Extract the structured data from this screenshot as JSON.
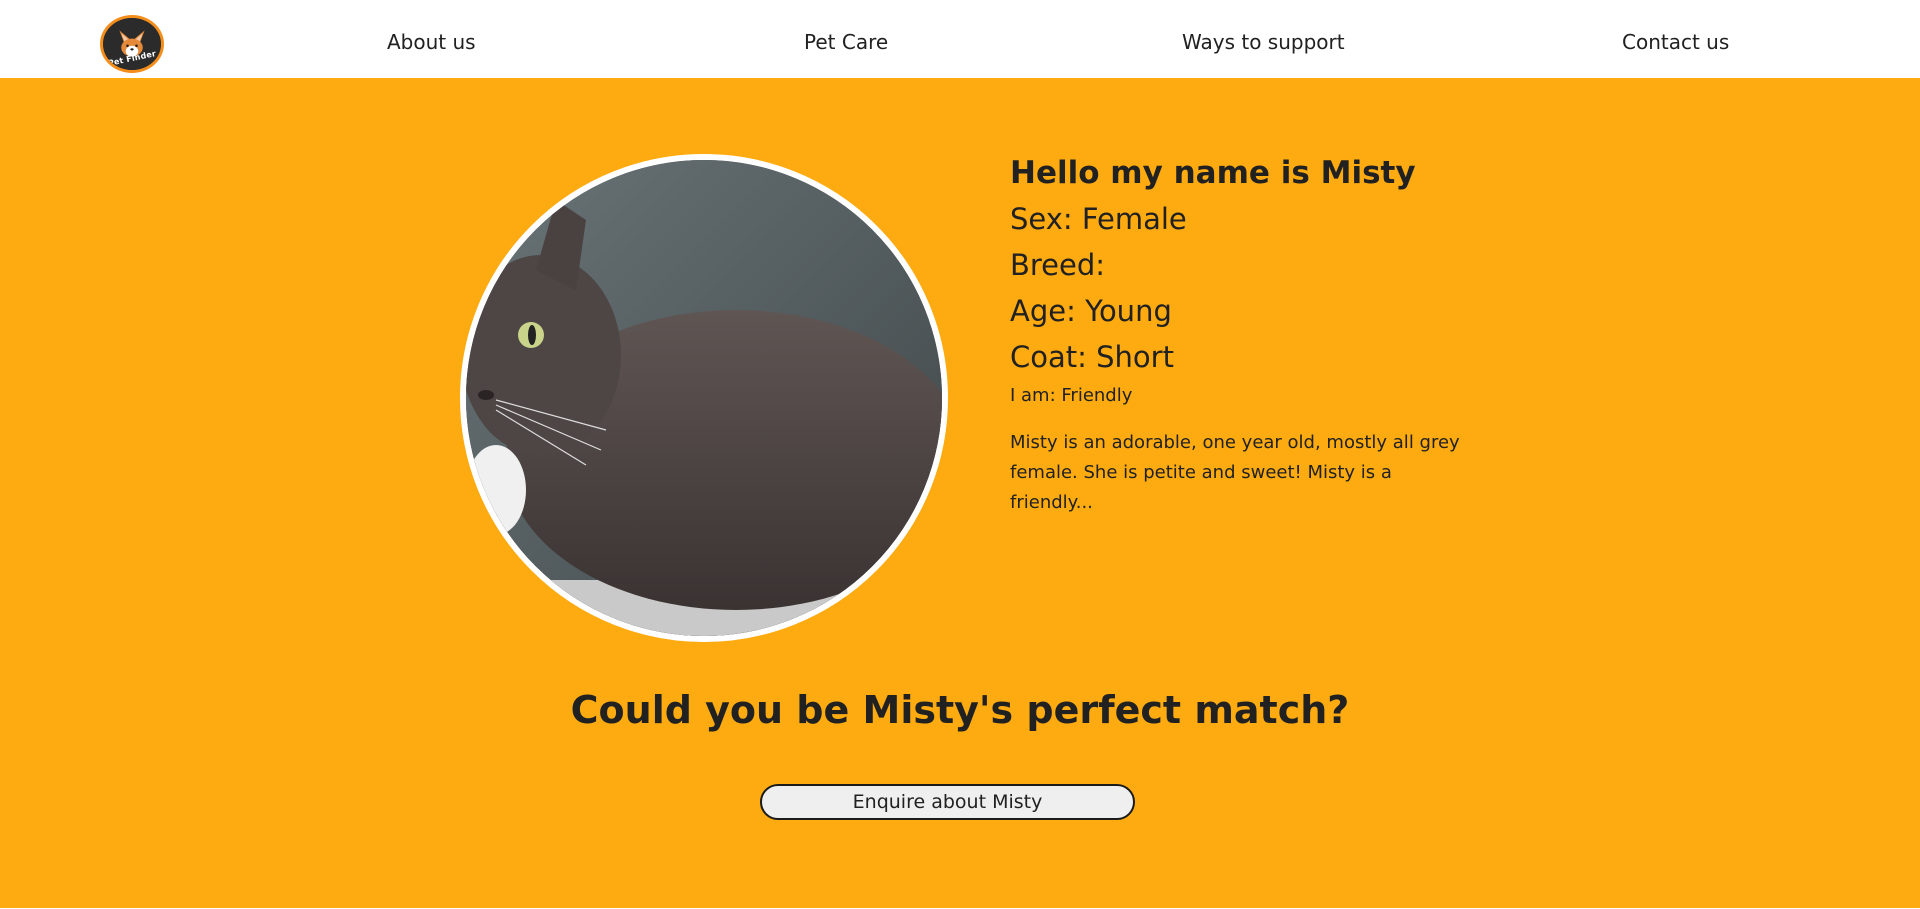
{
  "nav": {
    "logo_text": "Pet Finder",
    "links": [
      {
        "label": "About us"
      },
      {
        "label": "Pet Care"
      },
      {
        "label": "Ways to support"
      },
      {
        "label": "Contact us"
      }
    ]
  },
  "pet": {
    "heading": "Hello my name is Misty",
    "sex": "Sex: Female",
    "breed": "Breed:",
    "age": "Age: Young",
    "coat": "Coat: Short",
    "temperament": "I am: Friendly",
    "description": "Misty is an adorable, one year old, mostly all grey female. She is petite and sweet! Misty is a friendly..."
  },
  "cta": {
    "heading": "Could you be Misty's perfect match?",
    "button_label": "Enquire about Misty"
  },
  "icons": {
    "logo": "corgi-logo-icon",
    "photo": "cat-photo"
  },
  "colors": {
    "accent": "#feab12",
    "logo_ring": "#f58d1b",
    "text": "#212121",
    "button_bg": "#efefef"
  }
}
